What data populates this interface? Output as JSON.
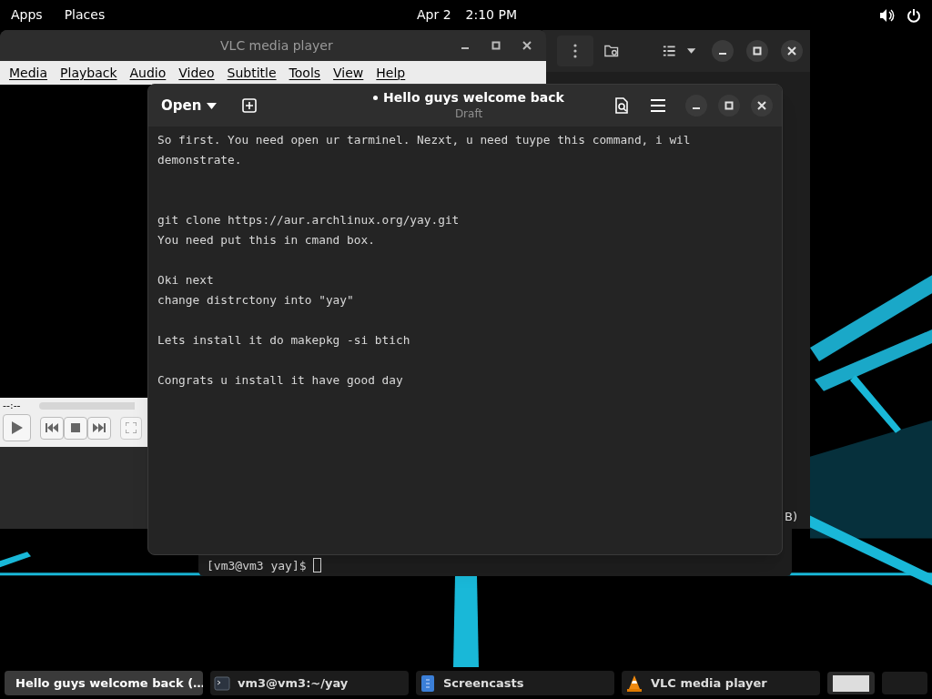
{
  "top_bar": {
    "menus": [
      "Apps",
      "Places"
    ],
    "date": "Apr 2",
    "time": "2:10 PM"
  },
  "file_window": {
    "visible_text": "B)"
  },
  "terminal": {
    "prompt": "[vm3@vm3 yay]$ "
  },
  "vlc": {
    "title": "VLC media player",
    "menu": [
      "Media",
      "Playback",
      "Audio",
      "Video",
      "Subtitle",
      "Tools",
      "View",
      "Help"
    ],
    "time": "--:--"
  },
  "editor": {
    "open_label": "Open",
    "title": "Hello guys welcome back",
    "modified": true,
    "subtitle": "Draft",
    "lines": [
      {
        "kind": "line",
        "text": "So first. You need open ur tarminel. Nezxt, u need tuype this command, i wil demonstrate."
      },
      {
        "kind": "blank"
      },
      {
        "kind": "blank"
      },
      {
        "kind": "line",
        "text": "git clone https://aur.archlinux.org/yay.git"
      },
      {
        "kind": "line",
        "text": "You need put this in cmand box."
      },
      {
        "kind": "blank"
      },
      {
        "kind": "line",
        "text": "Oki next"
      },
      {
        "kind": "line",
        "text": "change distrctony into \"yay\""
      },
      {
        "kind": "blank"
      },
      {
        "kind": "line",
        "text": "Lets install it do makepkg -si btich"
      },
      {
        "kind": "blank"
      },
      {
        "kind": "line",
        "text": "Congrats u install it have good day"
      }
    ]
  },
  "taskbar": [
    {
      "kind": "editor",
      "label": "Hello guys welcome back (…",
      "selected": true
    },
    {
      "kind": "terminal",
      "label": "vm3@vm3:~/yay",
      "selected": false
    },
    {
      "kind": "document",
      "label": "Screencasts",
      "selected": false
    },
    {
      "kind": "cone",
      "label": "VLC media player",
      "selected": false
    }
  ]
}
